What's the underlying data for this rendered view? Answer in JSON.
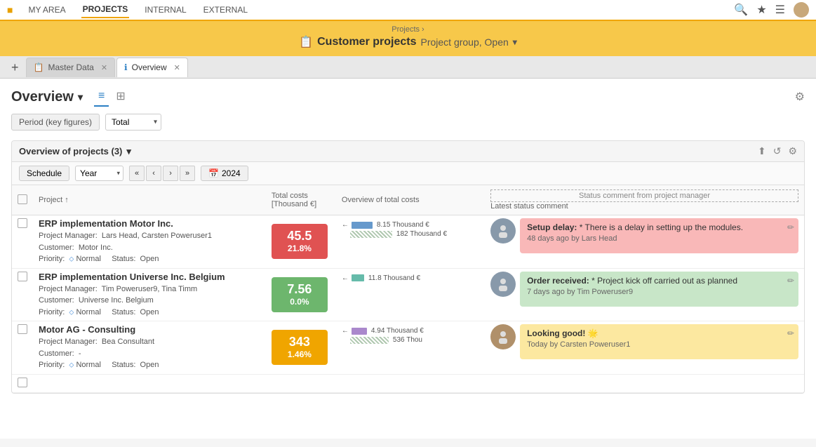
{
  "nav": {
    "logo": "■",
    "items": [
      "MY AREA",
      "PROJECTS",
      "INTERNAL",
      "EXTERNAL"
    ],
    "active": "PROJECTS"
  },
  "breadcrumb": {
    "parent": "Projects",
    "title": "Customer projects",
    "subtitle": "Project group, Open",
    "icon": "📋"
  },
  "tabs": [
    {
      "id": "master-data",
      "label": "Master Data",
      "icon": "📋",
      "active": false
    },
    {
      "id": "overview",
      "label": "Overview",
      "icon": "ℹ",
      "active": true
    }
  ],
  "overview": {
    "title": "Overview",
    "period_label": "Period (key figures)",
    "period_value": "Total",
    "filter_icon": "≡"
  },
  "projects_section": {
    "title": "Overview of projects (3)",
    "schedule_btn": "Schedule",
    "year_btn": "2024",
    "period_options": [
      "Year"
    ],
    "columns": {
      "project": "Project ↑",
      "total_costs": "Total costs\n[Thousand €]",
      "overview": "Overview of total costs",
      "comment": "Latest status comment"
    },
    "status_header": "Status comment from project manager",
    "projects": [
      {
        "id": 1,
        "name": "ERP implementation Motor Inc.",
        "manager": "Lars Head, Carsten Poweruser1",
        "customer": "Motor Inc.",
        "priority": "Normal",
        "status": "Open",
        "cost_value": "45.5",
        "cost_pct": "21.8%",
        "cost_color": "red",
        "chart_label1": "← 8.15 Thousand €",
        "chart_label2": "182 Thousand €",
        "bar1_width": 30,
        "bar2_width": 60,
        "comment_type": "red",
        "comment_title": "Setup delay:",
        "comment_text": "* There is a delay in setting up the modules.",
        "comment_time": "48 days ago by Lars Head",
        "avatar_type": "suit"
      },
      {
        "id": 2,
        "name": "ERP implementation Universe Inc. Belgium",
        "manager": "Tim Poweruser9, Tina Timm",
        "customer": "Universe Inc. Belgium",
        "priority": "Normal",
        "status": "Open",
        "cost_value": "7.56",
        "cost_pct": "0.0%",
        "cost_color": "green",
        "chart_label1": "← 11.8 Thousand €",
        "chart_label2": "",
        "bar1_width": 18,
        "bar2_width": 0,
        "comment_type": "green",
        "comment_title": "Order received:",
        "comment_text": "* Project kick off carried out as planned",
        "comment_time": "7 days ago by Tim Poweruser9",
        "avatar_type": "suit2"
      },
      {
        "id": 3,
        "name": "Motor AG - Consulting",
        "manager": "Bea Consultant",
        "customer": "-",
        "priority": "Normal",
        "status": "Open",
        "cost_value": "343",
        "cost_pct": "1.46%",
        "cost_color": "orange",
        "chart_label1": "← 4.94 Thousand €",
        "chart_label2": "536 Thou",
        "bar1_width": 22,
        "bar2_width": 55,
        "comment_type": "yellow",
        "comment_title": "Looking good! 🌟",
        "comment_text": "",
        "comment_time": "Today by Carsten Poweruser1",
        "avatar_type": "beard"
      }
    ]
  }
}
